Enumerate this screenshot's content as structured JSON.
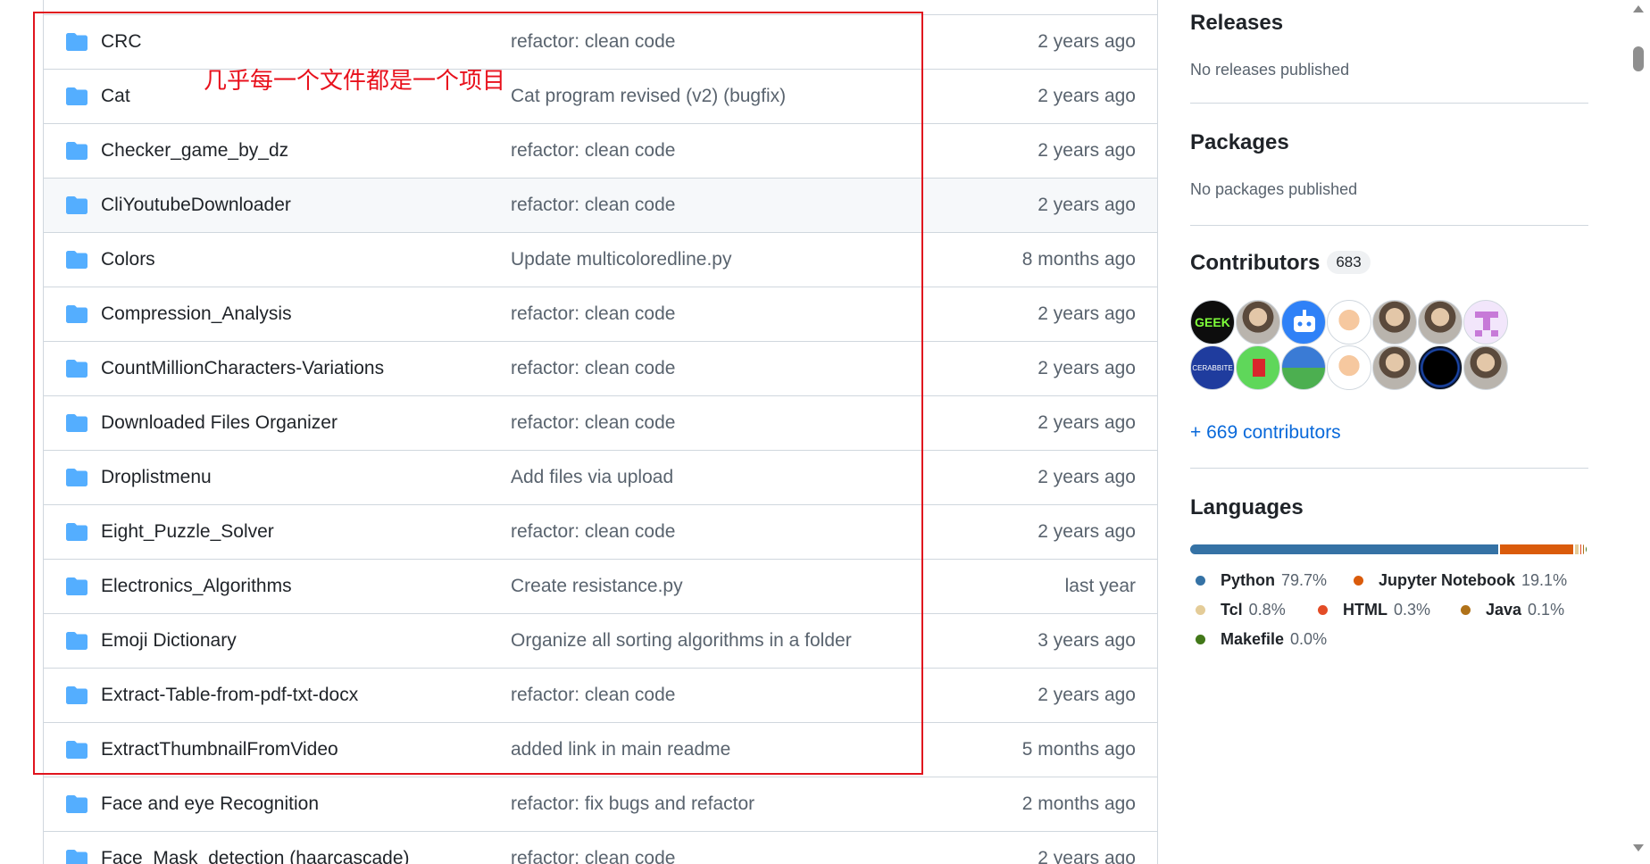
{
  "files": [
    {
      "name": "CRC",
      "message": "refactor: clean code",
      "age": "2 years ago"
    },
    {
      "name": "Cat",
      "message": "Cat program revised (v2) (bugfix)",
      "age": "2 years ago"
    },
    {
      "name": "Checker_game_by_dz",
      "message": "refactor: clean code",
      "age": "2 years ago"
    },
    {
      "name": "CliYoutubeDownloader",
      "message": "refactor: clean code",
      "age": "2 years ago"
    },
    {
      "name": "Colors",
      "message": "Update multicoloredline.py",
      "age": "8 months ago"
    },
    {
      "name": "Compression_Analysis",
      "message": "refactor: clean code",
      "age": "2 years ago"
    },
    {
      "name": "CountMillionCharacters-Variations",
      "message": "refactor: clean code",
      "age": "2 years ago"
    },
    {
      "name": "Downloaded Files Organizer",
      "message": "refactor: clean code",
      "age": "2 years ago"
    },
    {
      "name": "Droplistmenu",
      "message": "Add files via upload",
      "age": "2 years ago"
    },
    {
      "name": "Eight_Puzzle_Solver",
      "message": "refactor: clean code",
      "age": "2 years ago"
    },
    {
      "name": "Electronics_Algorithms",
      "message": "Create resistance.py",
      "age": "last year"
    },
    {
      "name": "Emoji Dictionary",
      "message": "Organize all sorting algorithms in a folder",
      "age": "3 years ago"
    },
    {
      "name": "Extract-Table-from-pdf-txt-docx",
      "message": "refactor: clean code",
      "age": "2 years ago"
    },
    {
      "name": "ExtractThumbnailFromVideo",
      "message": "added link in main readme",
      "age": "5 months ago"
    },
    {
      "name": "Face and eye Recognition",
      "message": "refactor: fix bugs and refactor",
      "age": "2 months ago"
    },
    {
      "name": "Face_Mask_detection (haarcascade)",
      "message": "refactor: clean code",
      "age": "2 years ago"
    }
  ],
  "annotation": {
    "text": "几乎每一个文件都是一个项目",
    "color": "#e0141e"
  },
  "sidebar": {
    "releases": {
      "title": "Releases",
      "subtitle": "No releases published"
    },
    "packages": {
      "title": "Packages",
      "subtitle": "No packages published"
    },
    "contributors": {
      "title": "Contributors",
      "count": "683",
      "more_link": "+ 669 contributors",
      "avatars": [
        {
          "icon": "geek-avatar",
          "label": "GEEK"
        },
        {
          "icon": "person-photo-avatar"
        },
        {
          "icon": "bot-avatar"
        },
        {
          "icon": "cartoon-avatar"
        },
        {
          "icon": "person-photo-avatar"
        },
        {
          "icon": "person-photo-avatar"
        },
        {
          "icon": "pixel-avatar"
        },
        {
          "icon": "cerabbite-avatar",
          "label": "CERABBITE"
        },
        {
          "icon": "green-avatar"
        },
        {
          "icon": "landscape-avatar"
        },
        {
          "icon": "cartoon-avatar"
        },
        {
          "icon": "person-photo-avatar"
        },
        {
          "icon": "dark-ring-avatar"
        },
        {
          "icon": "person-photo-avatar"
        }
      ]
    },
    "languages": {
      "title": "Languages",
      "items": [
        {
          "name": "Python",
          "percent": "79.7%",
          "value": 79.7,
          "color": "#3572A5"
        },
        {
          "name": "Jupyter Notebook",
          "percent": "19.1%",
          "value": 19.1,
          "color": "#DA5B0B"
        },
        {
          "name": "Tcl",
          "percent": "0.8%",
          "value": 0.8,
          "color": "#e4cc98"
        },
        {
          "name": "HTML",
          "percent": "0.3%",
          "value": 0.3,
          "color": "#e34c26"
        },
        {
          "name": "Java",
          "percent": "0.1%",
          "value": 0.1,
          "color": "#b07219"
        },
        {
          "name": "Makefile",
          "percent": "0.0%",
          "value": 0.0,
          "color": "#427819"
        }
      ]
    }
  }
}
